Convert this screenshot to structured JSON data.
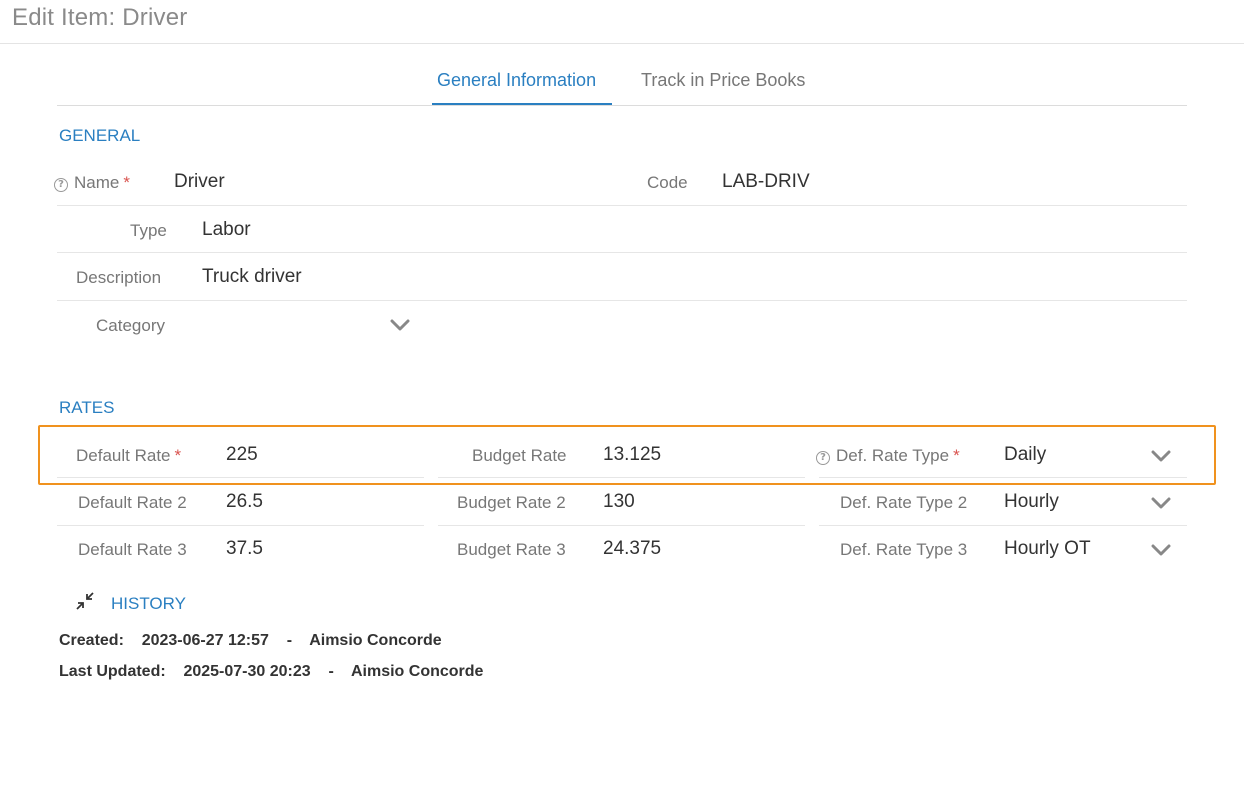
{
  "window": {
    "title": "Edit Item: Driver"
  },
  "tabs": [
    {
      "label": "General Information",
      "active": true
    },
    {
      "label": "Track in Price Books",
      "active": false
    }
  ],
  "general": {
    "heading": "GENERAL",
    "name_label": "Name",
    "name_value": "Driver",
    "code_label": "Code",
    "code_value": "LAB-DRIV",
    "type_label": "Type",
    "type_value": "Labor",
    "description_label": "Description",
    "description_value": "Truck driver",
    "category_label": "Category",
    "category_value": "",
    "required_mark": "*"
  },
  "rates": {
    "heading": "RATES",
    "rows": [
      {
        "default_label": "Default Rate",
        "default_value": "225",
        "default_required": true,
        "budget_label": "Budget Rate",
        "budget_value": "13.125",
        "type_label": "Def. Rate Type",
        "type_value": "Daily",
        "type_required": true
      },
      {
        "default_label": "Default Rate 2",
        "default_value": "26.5",
        "budget_label": "Budget Rate 2",
        "budget_value": "130",
        "type_label": "Def. Rate Type 2",
        "type_value": "Hourly"
      },
      {
        "default_label": "Default Rate 3",
        "default_value": "37.5",
        "budget_label": "Budget Rate 3",
        "budget_value": "24.375",
        "type_label": "Def. Rate Type 3",
        "type_value": "Hourly OT"
      }
    ]
  },
  "history": {
    "heading": "HISTORY",
    "created_label": "Created:",
    "created_date": "2023-06-27 12:57",
    "created_by": "Aimsio Concorde",
    "updated_label": "Last Updated:",
    "updated_date": "2025-07-30 20:23",
    "updated_by": "Aimsio Concorde",
    "separator": "-"
  },
  "colors": {
    "accent": "#2a7fc1",
    "highlight": "#f0921e",
    "required": "#d9534f"
  },
  "icons": [
    "help-icon",
    "chevron-down-icon",
    "collapse-arrows-icon"
  ]
}
